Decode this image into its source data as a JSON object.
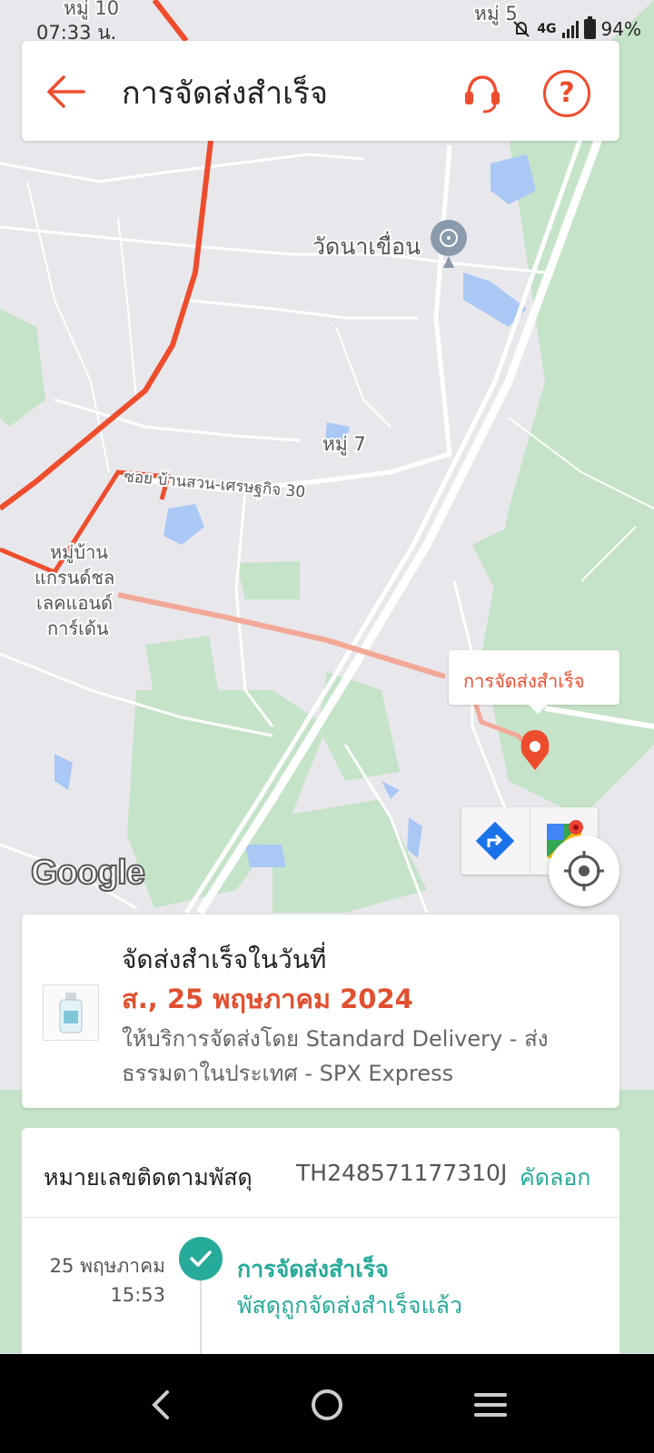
{
  "status_bar": {
    "time": "07:33 น.",
    "network": "4G",
    "battery": "94%"
  },
  "header": {
    "title": "การจัดส่งสำเร็จ",
    "icons": {
      "back": "back-arrow-icon",
      "support": "headset-icon",
      "help": "help-circle-icon"
    },
    "help_symbol": "?"
  },
  "map": {
    "labels": {
      "moo10": "หมู่ 10",
      "moo5": "หมู่ 5",
      "temple": "วัดนาเขื่อน",
      "moo7": "หมู่ 7",
      "soi": "ซอย บ้านสวน-เศรษฐกิจ 30",
      "village_l1": "หมู่บ้าน",
      "village_l2": "แกรนด์ชล",
      "village_l3": "เลคแอนด์",
      "village_l4": "การ์เด้น"
    },
    "callout": "การจัดส่งสำเร็จ",
    "google_logo": "Google",
    "accent_color": "#ee4d2d",
    "route_color": "#ee4d2d"
  },
  "delivery": {
    "status_line": "จัดส่งสำเร็จในวันที่",
    "date": "ส., 25 พฤษภาคม 2024",
    "service": "ให้บริการจัดส่งโดย Standard Delivery - ส่งธรรมดาในประเทศ - SPX Express"
  },
  "tracking": {
    "label": "หมายเลขติดตามพัสดุ",
    "number": "TH248571177310J",
    "copy_label": "คัดลอก",
    "events": [
      {
        "date": "25 พฤษภาคม",
        "time": "15:53",
        "title": "การจัดส่งสำเร็จ",
        "description": "พัสดุถูกจัดส่งสำเร็จแล้ว"
      }
    ],
    "status_color": "#26aa99"
  },
  "nav": {
    "icons": [
      "nav-back-icon",
      "nav-home-icon",
      "nav-menu-icon"
    ]
  }
}
